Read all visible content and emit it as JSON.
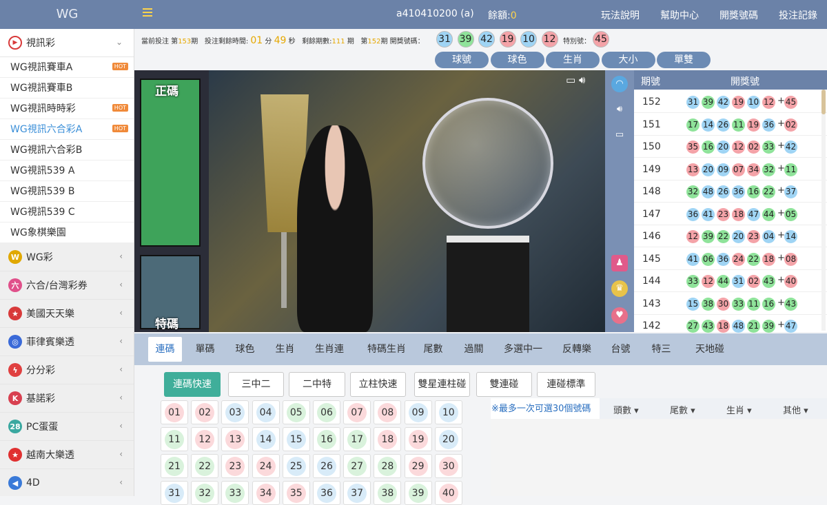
{
  "header": {
    "logo": "WG",
    "user": "a410410200 (a)",
    "balance_label": "餘額:",
    "balance_value": "0",
    "links": [
      "玩法說明",
      "幫助中心",
      "開獎號碼",
      "投注記錄"
    ]
  },
  "sidebar": {
    "open_section": {
      "label": "視訊彩",
      "icon": "video-play-icon"
    },
    "items": [
      {
        "label": "WG視訊賽車A",
        "hot": true
      },
      {
        "label": "WG視訊賽車B",
        "hot": false
      },
      {
        "label": "WG視訊時時彩",
        "hot": true
      },
      {
        "label": "WG視訊六合彩A",
        "hot": true,
        "active": true
      },
      {
        "label": "WG視訊六合彩B",
        "hot": false
      },
      {
        "label": "WG視訊539 A",
        "hot": false
      },
      {
        "label": "WG視訊539 B",
        "hot": false
      },
      {
        "label": "WG視訊539 C",
        "hot": false
      },
      {
        "label": "WG象棋樂園",
        "hot": false
      }
    ],
    "hot_label": "HOT",
    "sections": [
      {
        "label": "WG彩",
        "icon_text": "W",
        "color": "#e0a800"
      },
      {
        "label": "六合/台灣彩券",
        "icon_text": "六",
        "color": "#e0508a"
      },
      {
        "label": "美國天天樂",
        "icon_text": "★",
        "color": "#d83a3a"
      },
      {
        "label": "菲律賓樂透",
        "icon_text": "◎",
        "color": "#3a6ad8"
      },
      {
        "label": "分分彩",
        "icon_text": "ϟ",
        "color": "#e04040"
      },
      {
        "label": "基諾彩",
        "icon_text": "K",
        "color": "#d84050"
      },
      {
        "label": "PC蛋蛋",
        "icon_text": "28",
        "color": "#3aa8a0"
      },
      {
        "label": "越南大樂透",
        "icon_text": "★",
        "color": "#e03030"
      },
      {
        "label": "4D",
        "icon_text": "◀",
        "color": "#3a7ad8"
      }
    ]
  },
  "info": {
    "current_prefix": "當前投注 第",
    "current_period": "153",
    "current_suffix": "期",
    "time_label": "投注剩餘時間:",
    "minutes": "01",
    "min_unit": "分",
    "seconds": "49",
    "sec_unit": "秒",
    "remain_label": "剩餘期數:",
    "remain_value": "111",
    "remain_unit": "期",
    "last_prefix": "第",
    "last_period": "152",
    "last_suffix": "期 開獎號碼：",
    "last_balls": [
      {
        "n": "31",
        "c": "blue"
      },
      {
        "n": "39",
        "c": "green"
      },
      {
        "n": "42",
        "c": "blue"
      },
      {
        "n": "19",
        "c": "red"
      },
      {
        "n": "10",
        "c": "blue"
      },
      {
        "n": "12",
        "c": "red"
      }
    ],
    "special_label": "特別號：",
    "special_ball": {
      "n": "45",
      "c": "red"
    }
  },
  "view_pills": [
    "球號",
    "球色",
    "生肖",
    "大小",
    "單雙"
  ],
  "video": {
    "cam1_label": "正碼",
    "cam2_label": "特碼"
  },
  "history": {
    "col_period": "期號",
    "col_numbers": "開獎號",
    "plus": "+",
    "rows": [
      {
        "p": "152",
        "b": [
          [
            "31",
            "blue"
          ],
          [
            "39",
            "green"
          ],
          [
            "42",
            "blue"
          ],
          [
            "19",
            "red"
          ],
          [
            "10",
            "blue"
          ],
          [
            "12",
            "red"
          ]
        ],
        "s": [
          "45",
          "red"
        ]
      },
      {
        "p": "151",
        "b": [
          [
            "17",
            "green"
          ],
          [
            "14",
            "blue"
          ],
          [
            "26",
            "blue"
          ],
          [
            "11",
            "green"
          ],
          [
            "19",
            "red"
          ],
          [
            "36",
            "blue"
          ]
        ],
        "s": [
          "02",
          "red"
        ]
      },
      {
        "p": "150",
        "b": [
          [
            "35",
            "red"
          ],
          [
            "16",
            "green"
          ],
          [
            "20",
            "blue"
          ],
          [
            "12",
            "red"
          ],
          [
            "02",
            "red"
          ],
          [
            "33",
            "green"
          ]
        ],
        "s": [
          "42",
          "blue"
        ]
      },
      {
        "p": "149",
        "b": [
          [
            "13",
            "red"
          ],
          [
            "20",
            "blue"
          ],
          [
            "09",
            "blue"
          ],
          [
            "07",
            "red"
          ],
          [
            "34",
            "red"
          ],
          [
            "32",
            "green"
          ]
        ],
        "s": [
          "11",
          "green"
        ]
      },
      {
        "p": "148",
        "b": [
          [
            "32",
            "green"
          ],
          [
            "48",
            "blue"
          ],
          [
            "26",
            "blue"
          ],
          [
            "36",
            "blue"
          ],
          [
            "16",
            "green"
          ],
          [
            "22",
            "green"
          ]
        ],
        "s": [
          "37",
          "blue"
        ]
      },
      {
        "p": "147",
        "b": [
          [
            "36",
            "blue"
          ],
          [
            "41",
            "blue"
          ],
          [
            "23",
            "red"
          ],
          [
            "18",
            "red"
          ],
          [
            "47",
            "blue"
          ],
          [
            "44",
            "green"
          ]
        ],
        "s": [
          "05",
          "green"
        ]
      },
      {
        "p": "146",
        "b": [
          [
            "12",
            "red"
          ],
          [
            "39",
            "green"
          ],
          [
            "22",
            "green"
          ],
          [
            "20",
            "blue"
          ],
          [
            "23",
            "red"
          ],
          [
            "04",
            "blue"
          ]
        ],
        "s": [
          "14",
          "blue"
        ]
      },
      {
        "p": "145",
        "b": [
          [
            "41",
            "blue"
          ],
          [
            "06",
            "green"
          ],
          [
            "36",
            "blue"
          ],
          [
            "24",
            "red"
          ],
          [
            "22",
            "green"
          ],
          [
            "18",
            "red"
          ]
        ],
        "s": [
          "08",
          "red"
        ]
      },
      {
        "p": "144",
        "b": [
          [
            "33",
            "green"
          ],
          [
            "12",
            "red"
          ],
          [
            "44",
            "green"
          ],
          [
            "31",
            "blue"
          ],
          [
            "02",
            "red"
          ],
          [
            "43",
            "green"
          ]
        ],
        "s": [
          "40",
          "red"
        ]
      },
      {
        "p": "143",
        "b": [
          [
            "15",
            "blue"
          ],
          [
            "38",
            "green"
          ],
          [
            "30",
            "red"
          ],
          [
            "33",
            "green"
          ],
          [
            "11",
            "green"
          ],
          [
            "16",
            "green"
          ]
        ],
        "s": [
          "43",
          "green"
        ]
      },
      {
        "p": "142",
        "b": [
          [
            "27",
            "green"
          ],
          [
            "43",
            "green"
          ],
          [
            "18",
            "red"
          ],
          [
            "48",
            "blue"
          ],
          [
            "21",
            "green"
          ],
          [
            "39",
            "green"
          ]
        ],
        "s": [
          "47",
          "blue"
        ]
      }
    ]
  },
  "tabs": [
    "連碼",
    "單碼",
    "球色",
    "生肖",
    "生肖連",
    "特碼生肖",
    "尾數",
    "過關",
    "多選中一",
    "反轉樂",
    "台號",
    "特三",
    "天地碰"
  ],
  "subtabs": [
    "連碼快速",
    "三中二",
    "二中特",
    "立柱快速",
    "雙星連柱碰",
    "雙連碰",
    "連碰標準"
  ],
  "numbers": [
    [
      "01",
      "red"
    ],
    [
      "02",
      "red"
    ],
    [
      "03",
      "blue"
    ],
    [
      "04",
      "blue"
    ],
    [
      "05",
      "green"
    ],
    [
      "06",
      "green"
    ],
    [
      "07",
      "red"
    ],
    [
      "08",
      "red"
    ],
    [
      "09",
      "blue"
    ],
    [
      "10",
      "blue"
    ],
    [
      "11",
      "green"
    ],
    [
      "12",
      "red"
    ],
    [
      "13",
      "red"
    ],
    [
      "14",
      "blue"
    ],
    [
      "15",
      "blue"
    ],
    [
      "16",
      "green"
    ],
    [
      "17",
      "green"
    ],
    [
      "18",
      "red"
    ],
    [
      "19",
      "red"
    ],
    [
      "20",
      "blue"
    ],
    [
      "21",
      "green"
    ],
    [
      "22",
      "green"
    ],
    [
      "23",
      "red"
    ],
    [
      "24",
      "red"
    ],
    [
      "25",
      "blue"
    ],
    [
      "26",
      "blue"
    ],
    [
      "27",
      "green"
    ],
    [
      "28",
      "green"
    ],
    [
      "29",
      "red"
    ],
    [
      "30",
      "red"
    ],
    [
      "31",
      "blue"
    ],
    [
      "32",
      "green"
    ],
    [
      "33",
      "green"
    ],
    [
      "34",
      "red"
    ],
    [
      "35",
      "red"
    ],
    [
      "36",
      "blue"
    ],
    [
      "37",
      "blue"
    ],
    [
      "38",
      "green"
    ],
    [
      "39",
      "green"
    ],
    [
      "40",
      "red"
    ]
  ],
  "selection": {
    "note": "※最多一次可選30個號碼",
    "filters": [
      "頭數",
      "尾數",
      "生肖",
      "其他"
    ]
  }
}
